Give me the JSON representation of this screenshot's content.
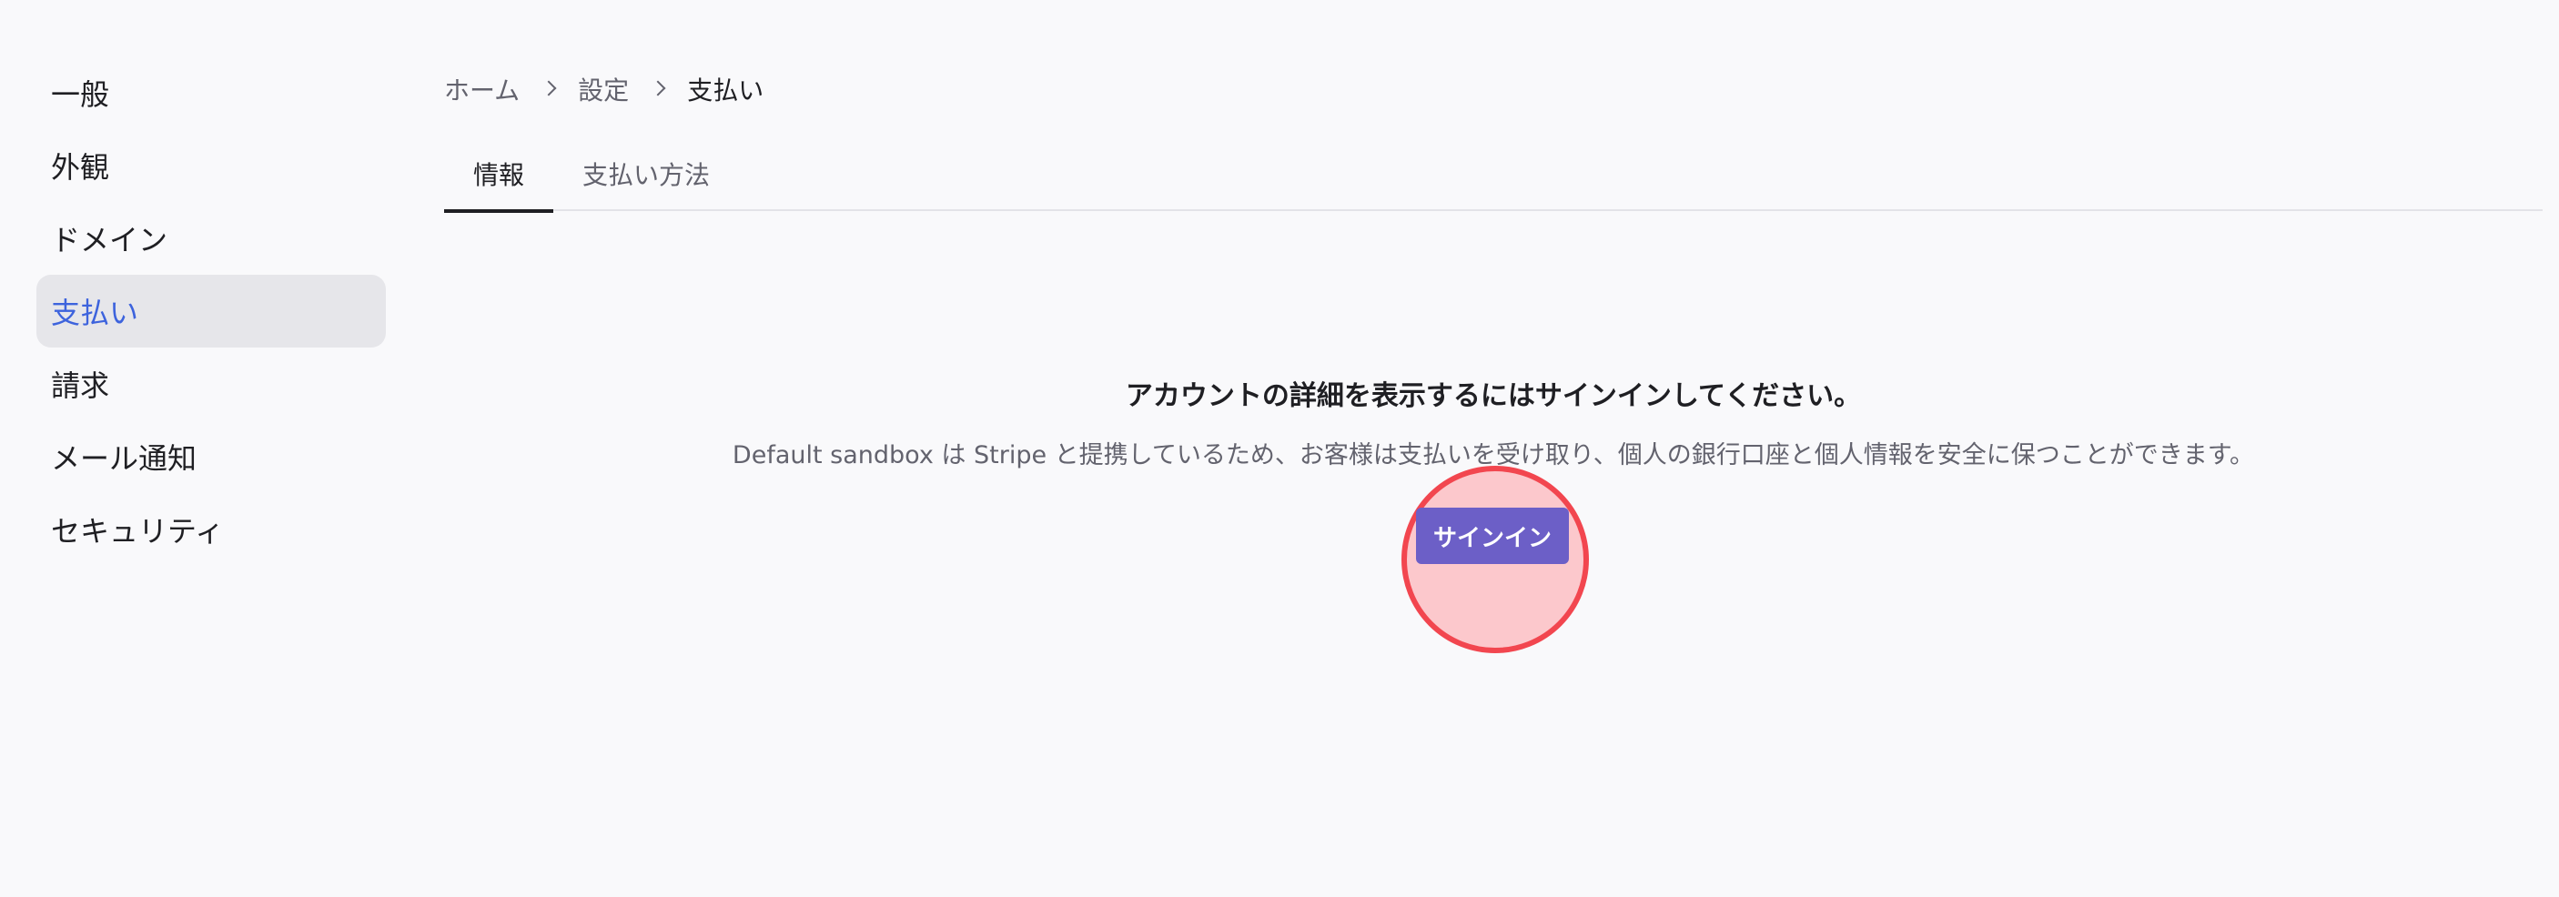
{
  "sidebar": {
    "items": [
      {
        "label": "一般"
      },
      {
        "label": "外観"
      },
      {
        "label": "ドメイン"
      },
      {
        "label": "支払い",
        "active": true
      },
      {
        "label": "請求"
      },
      {
        "label": "メール通知"
      },
      {
        "label": "セキュリティ"
      }
    ]
  },
  "breadcrumb": {
    "items": [
      "ホーム",
      "設定",
      "支払い"
    ]
  },
  "tabs": [
    {
      "label": "情報",
      "active": true
    },
    {
      "label": "支払い方法"
    }
  ],
  "main": {
    "heading": "アカウントの詳細を表示するにはサインインしてください。",
    "description": "Default sandbox は Stripe と提携しているため、お客様は支払いを受け取り、個人の銀行口座と個人情報を安全に保つことができます。",
    "signin_label": "サインイン"
  },
  "colors": {
    "accent": "#3d63dd",
    "button": "#6c5fc7",
    "highlight_ring": "#f2464f"
  }
}
